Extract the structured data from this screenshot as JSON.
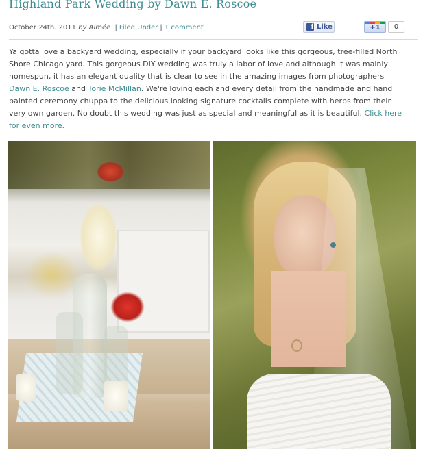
{
  "post": {
    "title": "Highland Park Wedding by Dawn E. Roscoe",
    "date": "October 24th. 2011",
    "by_label": "by",
    "author": "Aimée",
    "separator": "|",
    "filed_under": "Filed Under",
    "comments": "1 comment"
  },
  "social": {
    "facebook_label": "Like",
    "facebook_icon": "f",
    "plusone_label": "+1",
    "plusone_count": "0"
  },
  "body": {
    "part1": "Ya gotta love a backyard wedding, especially if your backyard looks like this gorgeous, tree-filled North Shore Chicago yard. This gorgeous DIY wedding was truly a labor of love and although it was mainly homespun, it has an elegant quality that is clear to see in the amazing images from photographers ",
    "link1": "Dawn E. Roscoe",
    "and": " and ",
    "link2": "Torie McMillan",
    "part2": ". We're loving each and every detail from the handmade and hand painted ceremony chuppa to the delicious looking signature cocktails complete with herbs from their very own garden. No doubt this wedding was just as special and meaningful as it is beautiful. ",
    "link3": "Click here for even more."
  },
  "colors": {
    "link": "#3d8c91",
    "text": "#444444",
    "facebook": "#3b5998"
  }
}
